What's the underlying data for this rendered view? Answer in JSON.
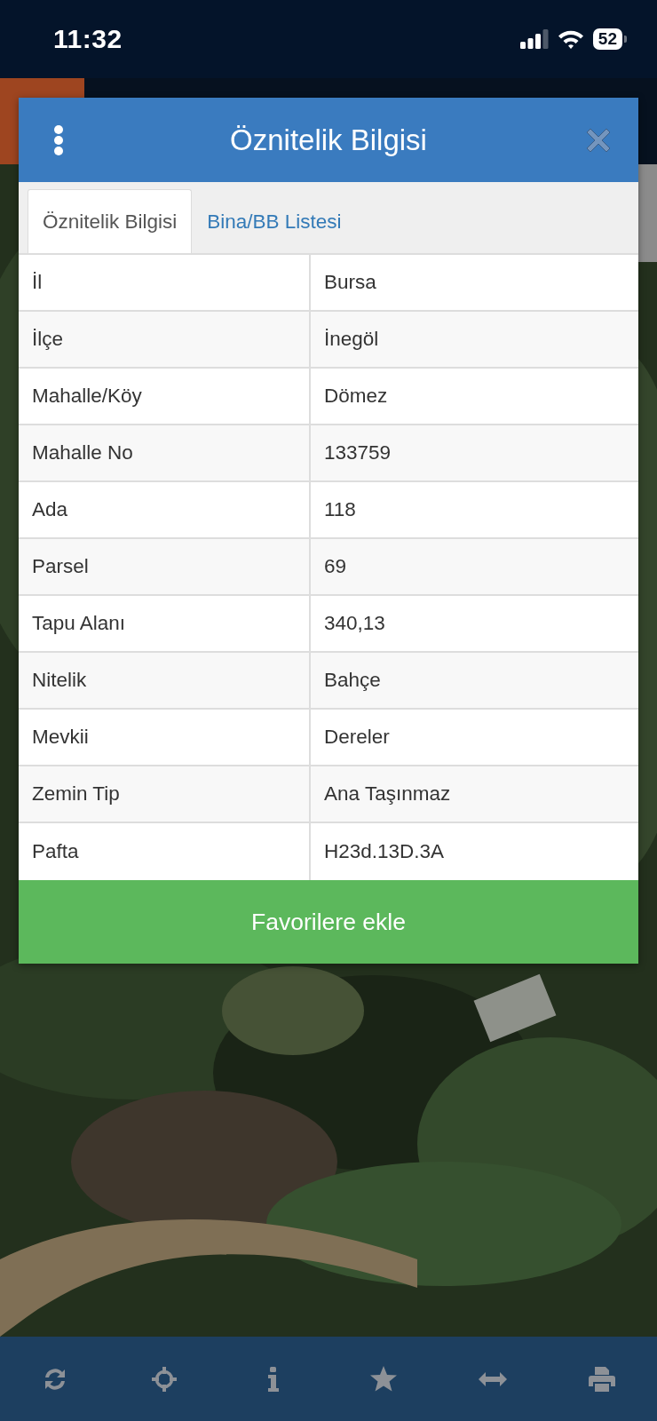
{
  "status_bar": {
    "time": "11:32",
    "battery": "52"
  },
  "dialog": {
    "title": "Öznitelik Bilgisi",
    "tabs": [
      {
        "label": "Öznitelik Bilgisi",
        "selected": true
      },
      {
        "label": "Bina/BB Listesi",
        "selected": false
      }
    ],
    "rows": [
      {
        "label": "İl",
        "value": "Bursa"
      },
      {
        "label": "İlçe",
        "value": "İnegöl"
      },
      {
        "label": "Mahalle/Köy",
        "value": "Dömez"
      },
      {
        "label": "Mahalle No",
        "value": "133759"
      },
      {
        "label": "Ada",
        "value": "118"
      },
      {
        "label": "Parsel",
        "value": "69"
      },
      {
        "label": "Tapu Alanı",
        "value": "340,13"
      },
      {
        "label": "Nitelik",
        "value": "Bahçe"
      },
      {
        "label": "Mevkii",
        "value": "Dereler"
      },
      {
        "label": "Zemin Tip",
        "value": "Ana Taşınmaz"
      },
      {
        "label": "Pafta",
        "value": "H23d.13D.3A"
      }
    ],
    "button": "Favorilere ekle"
  }
}
